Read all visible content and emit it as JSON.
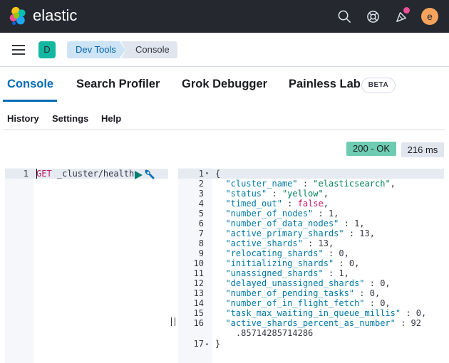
{
  "header": {
    "brand": "elastic",
    "avatar_letter": "e",
    "icons": [
      "search-icon",
      "help-icon",
      "newsfeed-icon"
    ],
    "notification_color": "#f04e98"
  },
  "nav": {
    "space_letter": "D",
    "breadcrumbs": [
      "Dev Tools",
      "Console"
    ]
  },
  "tabs": [
    {
      "label": "Console"
    },
    {
      "label": "Search Profiler"
    },
    {
      "label": "Grok Debugger"
    },
    {
      "label": "Painless Lab"
    }
  ],
  "beta_label": "BETA",
  "submenu": [
    "History",
    "Settings",
    "Help"
  ],
  "status": {
    "code": "200 - OK",
    "time": "216 ms"
  },
  "request": {
    "line_number": "1",
    "method": "GET",
    "path": " _cluster/health"
  },
  "response": {
    "line_numbers": [
      "1",
      "2",
      "3",
      "4",
      "5",
      "6",
      "7",
      "8",
      "9",
      "10",
      "11",
      "12",
      "13",
      "14",
      "15",
      "16",
      "",
      "17"
    ],
    "lines": [
      "{",
      "  \"cluster_name\" : \"elasticsearch\",",
      "  \"status\" : \"yellow\",",
      "  \"timed_out\" : false,",
      "  \"number_of_nodes\" : 1,",
      "  \"number_of_data_nodes\" : 1,",
      "  \"active_primary_shards\" : 13,",
      "  \"active_shards\" : 13,",
      "  \"relocating_shards\" : 0,",
      "  \"initializing_shards\" : 0,",
      "  \"unassigned_shards\" : 1,",
      "  \"delayed_unassigned_shards\" : 0,",
      "  \"number_of_pending_tasks\" : 0,",
      "  \"number_of_in_flight_fetch\" : 0,",
      "  \"task_max_waiting_in_queue_millis\" : 0,",
      "  \"active_shards_percent_as_number\" : 92",
      "    .85714285714286",
      "}"
    ]
  }
}
